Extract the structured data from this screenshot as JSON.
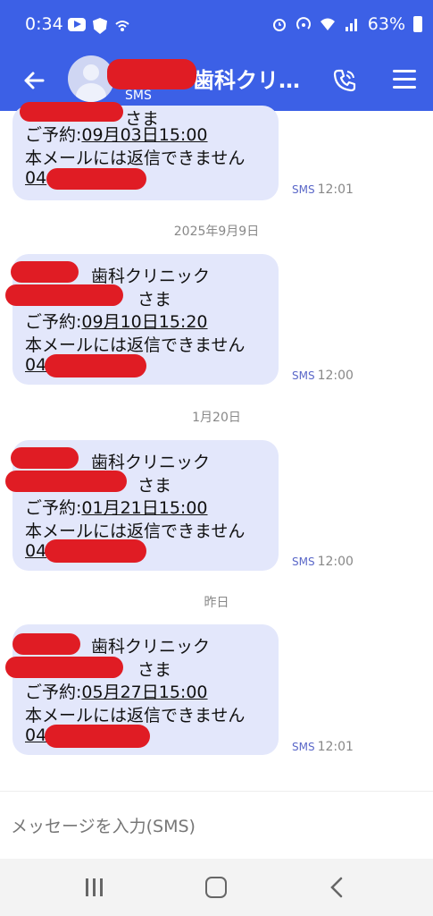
{
  "status_bar": {
    "time": "0:34",
    "battery": "63%"
  },
  "header": {
    "name_suffix": "歯科クリ…",
    "subtitle": "SMS"
  },
  "input": {
    "placeholder": "メッセージを入力(SMS)"
  },
  "messages": [
    {
      "partial": true,
      "salutation_suffix": "さま",
      "appointment_label": "ご予約:",
      "appointment_value": "09月03日15:00",
      "notice": "本メールには返信できません",
      "phone_prefix": "04",
      "channel": "SMS",
      "time": "12:01"
    },
    {
      "date_separator": "2025年9月9日",
      "clinic_suffix": "歯科クリニック",
      "salutation_suffix": "さま",
      "appointment_label": "ご予約:",
      "appointment_value": "09月10日15:20",
      "notice": "本メールには返信できません",
      "phone_prefix": "04",
      "channel": "SMS",
      "time": "12:00"
    },
    {
      "date_separator": "1月20日",
      "clinic_suffix": "歯科クリニック",
      "salutation_suffix": "さま",
      "appointment_label": "ご予約:",
      "appointment_value": "01月21日15:00",
      "notice": "本メールには返信できません",
      "phone_prefix": "04",
      "channel": "SMS",
      "time": "12:00"
    },
    {
      "date_separator": "昨日",
      "clinic_suffix": "歯科クリニック",
      "salutation_suffix": "さま",
      "appointment_label": "ご予約:",
      "appointment_value": "05月27日15:00",
      "notice": "本メールには返信できません",
      "phone_prefix": "04",
      "channel": "SMS",
      "time": "12:01"
    }
  ],
  "colors": {
    "accent": "#3c60e6",
    "bubble": "#e3e7fb",
    "redaction": "#e01c24"
  },
  "icons": [
    "back-arrow-icon",
    "phone-icon",
    "menu-icon",
    "avatar-icon",
    "nav-recent-icon",
    "nav-home-icon",
    "nav-back-icon"
  ]
}
